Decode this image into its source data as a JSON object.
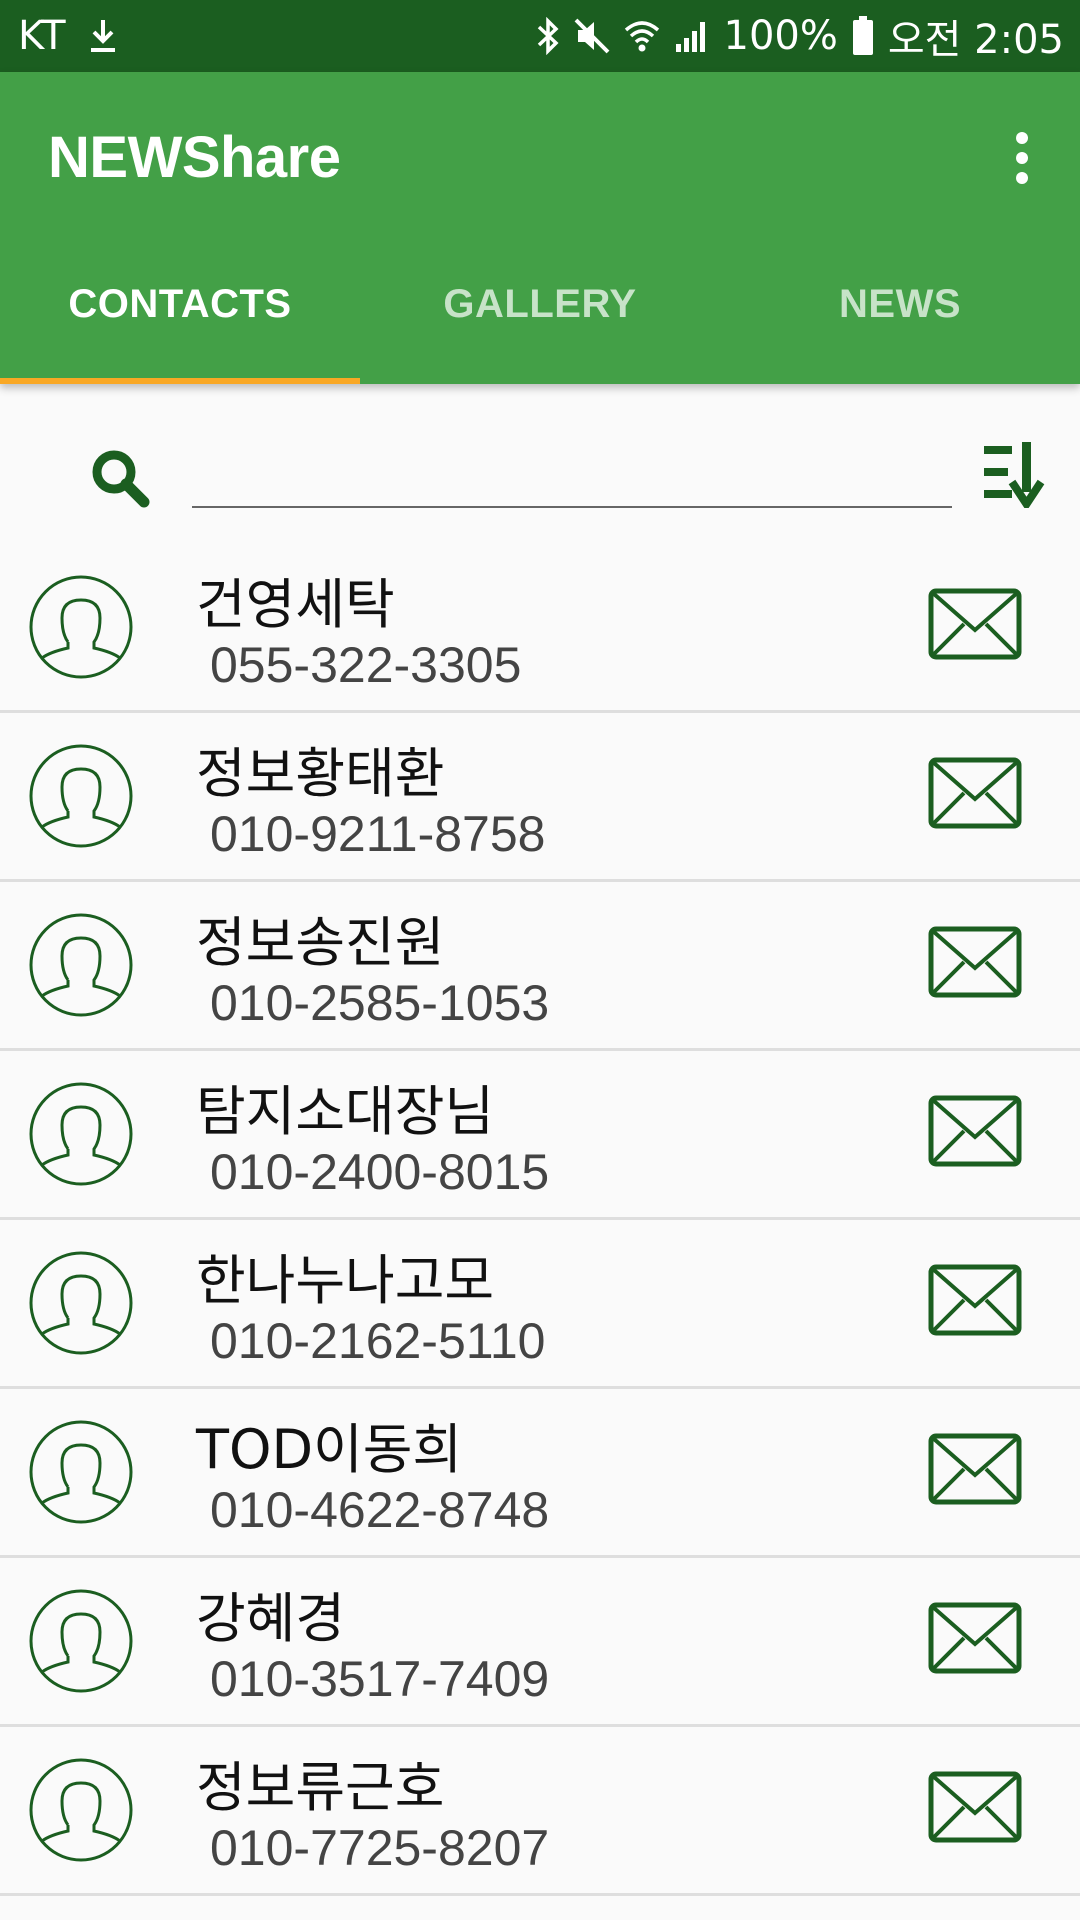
{
  "status_bar": {
    "carrier": "KT",
    "battery": "100%",
    "time": "오전 2:05"
  },
  "app_bar": {
    "title": "NEWShare"
  },
  "tabs": [
    {
      "label": "CONTACTS",
      "active": true
    },
    {
      "label": "GALLERY",
      "active": false
    },
    {
      "label": "NEWS",
      "active": false
    }
  ],
  "search": {
    "value": ""
  },
  "contacts": [
    {
      "name": "건영세탁",
      "phone": "055-322-3305"
    },
    {
      "name": "정보황태환",
      "phone": "010-9211-8758"
    },
    {
      "name": "정보송진원",
      "phone": "010-2585-1053"
    },
    {
      "name": "탐지소대장님",
      "phone": "010-2400-8015"
    },
    {
      "name": "한나누나고모",
      "phone": "010-2162-5110"
    },
    {
      "name": "TOD이동희",
      "phone": "010-4622-8748"
    },
    {
      "name": "강혜경",
      "phone": "010-3517-7409"
    },
    {
      "name": "정보류근호",
      "phone": "010-7725-8207"
    }
  ],
  "colors": {
    "status_bar": "#1b5e20",
    "app_bar": "#43a047",
    "tab_indicator": "#f9a825",
    "icon_green": "#1b5e20"
  }
}
